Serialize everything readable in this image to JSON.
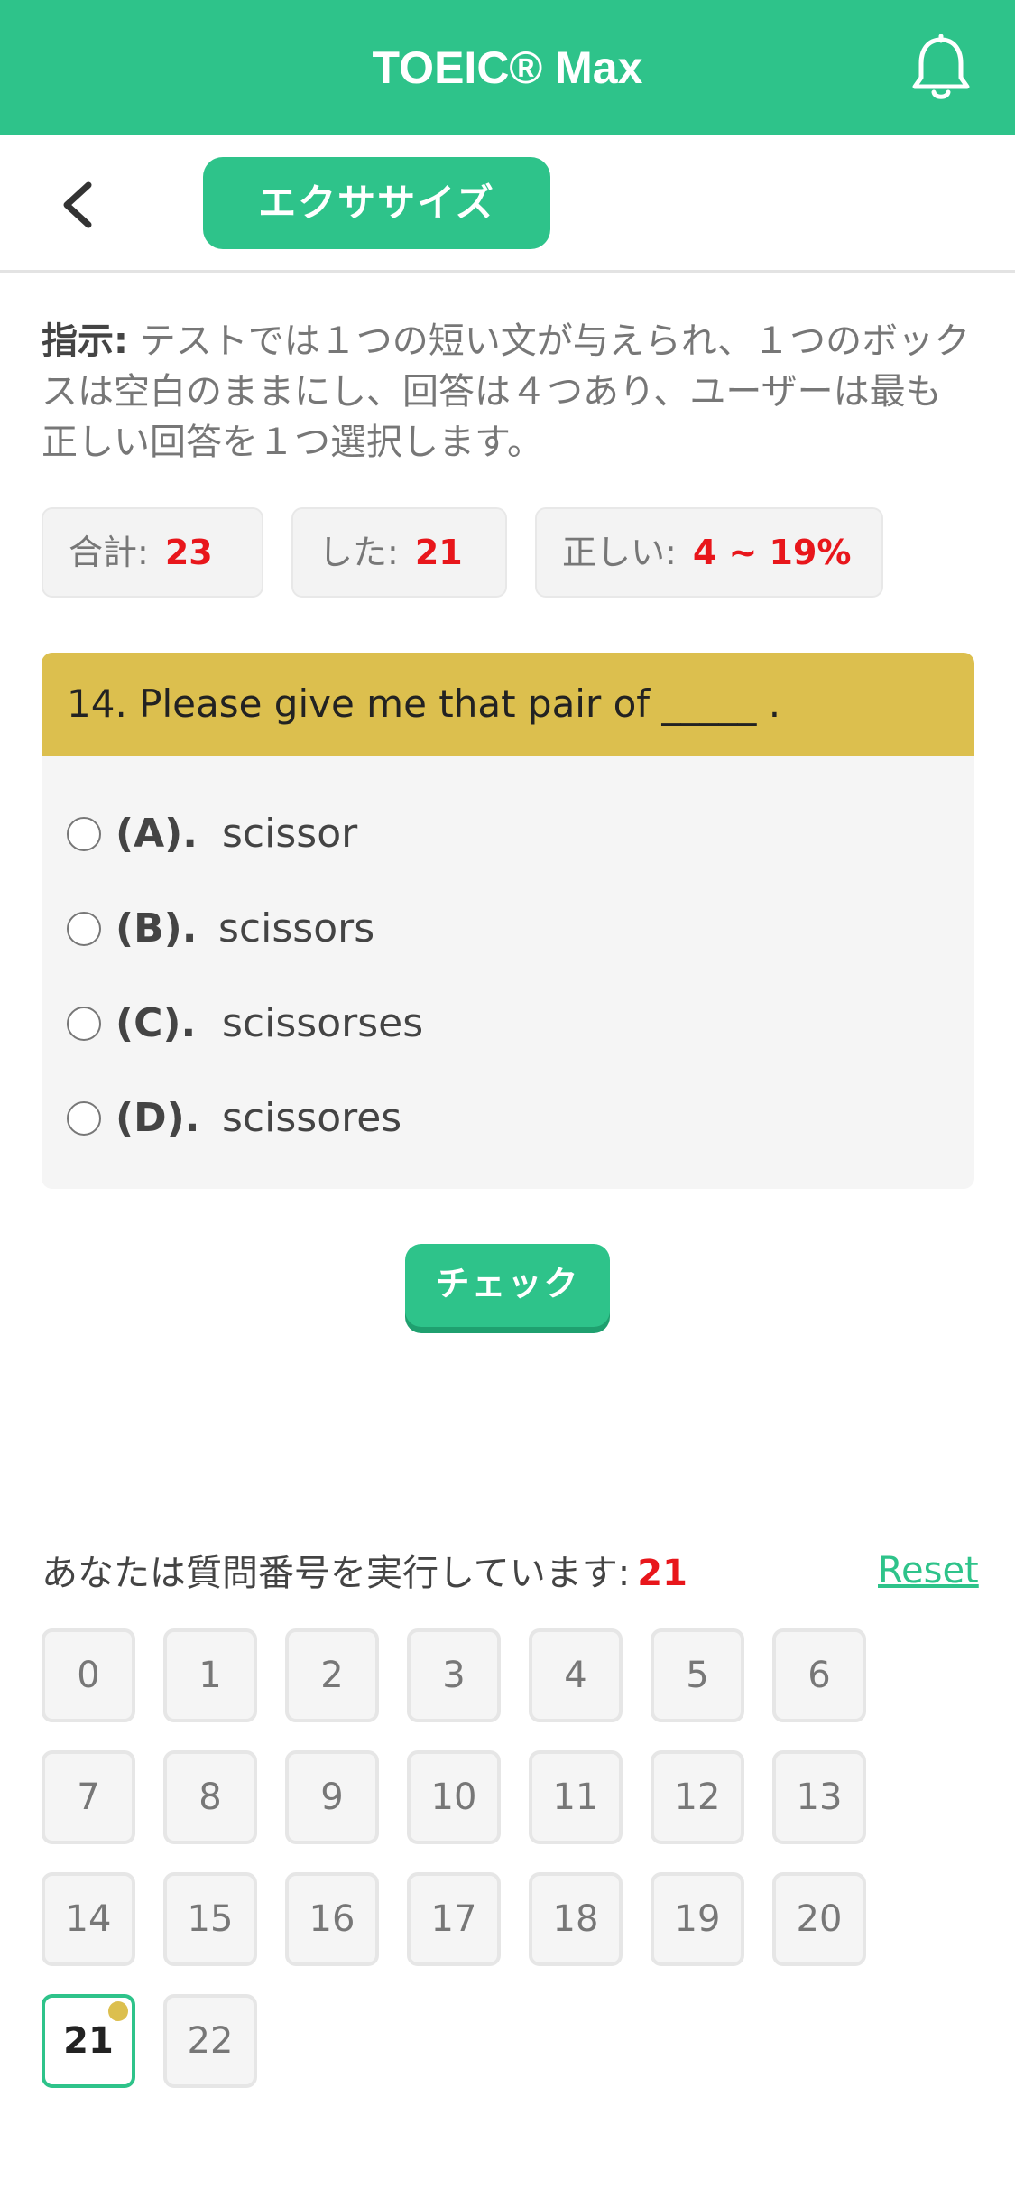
{
  "app": {
    "title": "TOEIC® Max"
  },
  "subheader": {
    "tab_label": "エクササイズ"
  },
  "instruction": {
    "label": "指示:",
    "text": " テストでは１つの短い文が与えられ、１つのボックスは空白のままにし、回答は４つあり、ユーザーは最も正しい回答を１つ選択します。"
  },
  "stats": {
    "total_label": "合計:",
    "total_value": "23",
    "done_label": "した:",
    "done_value": "21",
    "correct_label": "正しい:",
    "correct_value": "4 ~ 19%"
  },
  "question": {
    "text": "14. Please give me that pair of _____ .",
    "options": [
      {
        "letter": "(A).",
        "text": "scissor"
      },
      {
        "letter": "(B).",
        "text": "scissors"
      },
      {
        "letter": "(C).",
        "text": "scissorses"
      },
      {
        "letter": "(D).",
        "text": "scissores"
      }
    ]
  },
  "check_button": {
    "label": "チェック"
  },
  "progress": {
    "label": "あなたは質問番号を実行しています:",
    "current": "21",
    "reset_label": "Reset"
  },
  "numbers": [
    "0",
    "1",
    "2",
    "3",
    "4",
    "5",
    "6",
    "7",
    "8",
    "9",
    "10",
    "11",
    "12",
    "13",
    "14",
    "15",
    "16",
    "17",
    "18",
    "19",
    "20",
    "21",
    "22"
  ],
  "active_number": "21",
  "colors": {
    "brand": "#2ec38a",
    "question_header": "#dcbf4e",
    "accent_red": "#e8161b"
  },
  "icons": {
    "bell": "bell-icon",
    "back": "chevron-left-icon"
  }
}
